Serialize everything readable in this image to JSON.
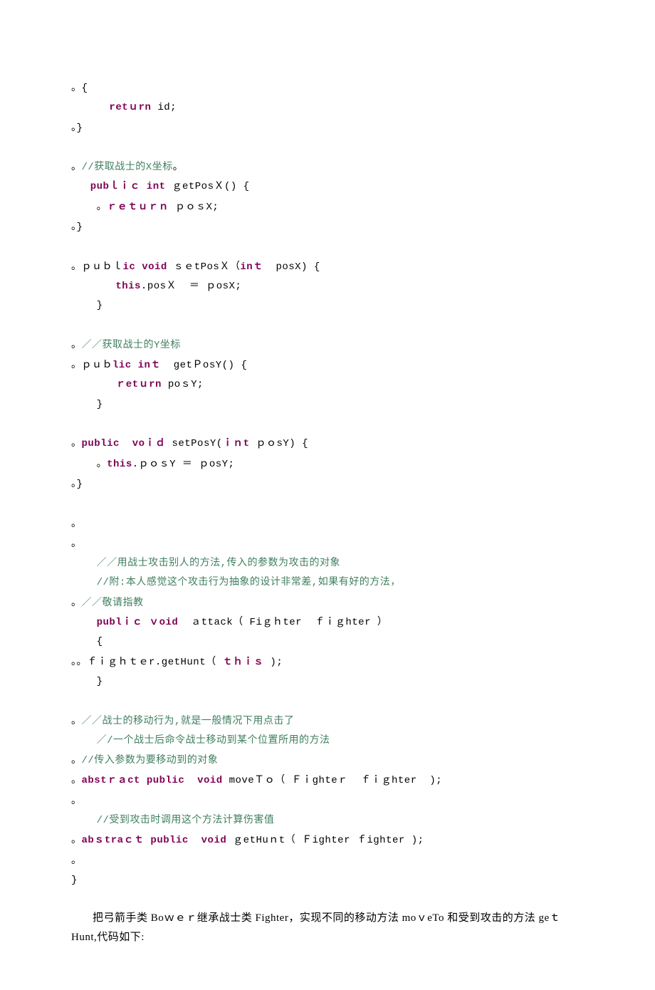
{
  "code": {
    "l01": "{",
    "l02_a": "      ",
    "l02_kw": "retｕrn",
    "l02_b": " id;",
    "l03": "}",
    "l04": "",
    "l05_c": "//获取战士的X坐标",
    "l06_a": "   ",
    "l06_kw1": "pubｌｉｃ",
    "l06_sp1": " ",
    "l06_kw2": "int",
    "l06_b": " ｇetPosＸ() {",
    "l07_a": "    ",
    "l07_kw": "ｒｅｔｕｒｎ",
    "l07_b": " ｐｏｓX;",
    "l08": "}",
    "l09": "",
    "l10_a": "ｐｕｂｌ",
    "l10_kw": "ic void",
    "l10_b": " ｓｅtPosＸ（",
    "l10_kw2": "inｔ",
    "l10_c": "  posX) {",
    "l11_a": "       ",
    "l11_kw": "this",
    "l11_b": ".posＸ  ＝ ｐosX;",
    "l12": "    }",
    "l13": "",
    "l14_c": "／／获取战士的Y坐标",
    "l15_a": "ｐｕｂ",
    "l15_kw": "lic inｔ",
    "l15_b": "  getＰosY() {",
    "l16_a": "       ",
    "l16_kw": "ｒetｕrn",
    "l16_b": " poｓY;",
    "l17": "    }",
    "l18": "",
    "l19_kw1": "public",
    "l19_a": "  ",
    "l19_kw2": "voｉｄ",
    "l19_b": " setPosY(",
    "l19_kw3": "ｉｎt",
    "l19_c": " ｐｏsY) {",
    "l20_a": "    ",
    "l20_kw": "this",
    "l20_b": ".ｐｏｓY ＝ ｐosY;",
    "l21": "}",
    "l22": "",
    "l23": "",
    "l24": "",
    "l25_a": "    ",
    "l25_c": "／／用战士攻击别人的方法,传入的参数为攻击的对象",
    "l26_a": "    ",
    "l26_c": "//附:本人感觉这个攻击行为抽象的设计非常差,如果有好的方法，",
    "l27_c": "／／敬请指教",
    "l28_a": "    ",
    "l28_kw1": "publｉｃ",
    "l28_sp1": " ",
    "l28_kw2": "ｖoid",
    "l28_b": "  ａttack（ Fiｇｈter  ｆｉｇhter ）",
    "l29": "    {",
    "l30_a": "ｆｉｇｈｔｅr.getHunt（ ",
    "l30_kw": "ｔｈｉｓ",
    "l30_b": " );",
    "l31": "    }",
    "l32": "",
    "l33_c": "／／战士的移动行为,就是一般情况下用点击了",
    "l34_a": "    ",
    "l34_c": "／/一个战士后命令战士移动到某个位置所用的方法",
    "l35_c": "//传入参数为要移动到的对象",
    "l36_kw1": "abstｒａct",
    "l36_sp1": " ",
    "l36_kw2": "public",
    "l36_sp2": "  ",
    "l36_kw3": "void",
    "l36_b": " moveＴｏ（ Ｆｉghteｒ  ｆｉｇhter  );",
    "l37": "",
    "l38_a": "    ",
    "l38_c": "//受到攻击时调用这个方法计算伤害值",
    "l39_kw1": "abｓtraｃｔ",
    "l39_sp1": " ",
    "l39_kw2": "public",
    "l39_sp2": "  ",
    "l39_kw3": "void",
    "l39_b": " ｇetHuｎt（ Ｆighter ｆighter );",
    "l40": "",
    "l41": "}"
  },
  "prose": {
    "p1": "把弓箭手类 Boｗｅｒ继承战士类 Fighter，实现不同的移动方法 moｖeTo 和受到攻击的方法 geｔHunt,代码如下:"
  },
  "bullet": "。"
}
